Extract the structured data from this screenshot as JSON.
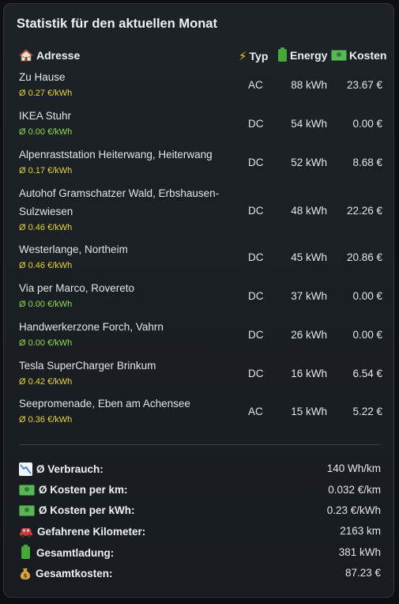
{
  "title": "Statistik für den aktuellen Monat",
  "header": {
    "address": "Adresse",
    "type": "Typ",
    "energy": "Energy",
    "cost": "Kosten"
  },
  "icons": {
    "address": "house-icon",
    "type": "lightning-icon",
    "energy": "battery-icon",
    "cost": "money-icon",
    "consumption": "chart-decreasing-icon",
    "cost_per_km": "money-icon",
    "cost_per_kwh": "money-icon",
    "distance": "car-icon",
    "total_charge": "battery-icon",
    "total_cost": "money-bag-icon"
  },
  "colors": {
    "avg_price": "#e8d532",
    "avg_price_zero": "#8fdc4a"
  },
  "rows": [
    {
      "address": "Zu Hause",
      "avg": "Ø 0.27 €/kWh",
      "type": "AC",
      "energy": "88 kWh",
      "cost": "23.67 €"
    },
    {
      "address": "IKEA Stuhr",
      "avg": "Ø 0.00 €/kWh",
      "type": "DC",
      "energy": "54 kWh",
      "cost": "0.00 €"
    },
    {
      "address": "Alpenraststation Heiterwang, Heiterwang",
      "avg": "Ø 0.17 €/kWh",
      "type": "DC",
      "energy": "52 kWh",
      "cost": "8.68 €"
    },
    {
      "address": "Autohof Gramschatzer Wald, Erbshausen-Sulzwiesen",
      "avg": "Ø 0.46 €/kWh",
      "type": "DC",
      "energy": "48 kWh",
      "cost": "22.26 €"
    },
    {
      "address": "Westerlange, Northeim",
      "avg": "Ø 0.46 €/kWh",
      "type": "DC",
      "energy": "45 kWh",
      "cost": "20.86 €"
    },
    {
      "address": "Via per Marco, Rovereto",
      "avg": "Ø 0.00 €/kWh",
      "type": "DC",
      "energy": "37 kWh",
      "cost": "0.00 €"
    },
    {
      "address": "Handwerkerzone Forch, Vahrn",
      "avg": "Ø 0.00 €/kWh",
      "type": "DC",
      "energy": "26 kWh",
      "cost": "0.00 €"
    },
    {
      "address": "Tesla SuperCharger Brinkum",
      "avg": "Ø 0.42 €/kWh",
      "type": "DC",
      "energy": "16 kWh",
      "cost": "6.54 €"
    },
    {
      "address": "Seepromenade, Eben am Achensee",
      "avg": "Ø 0.36 €/kWh",
      "type": "AC",
      "energy": "15 kWh",
      "cost": "5.22 €"
    }
  ],
  "stats": {
    "consumption_label": "Ø Verbrauch:",
    "consumption_value": "140 Wh/km",
    "cost_per_km_label": "Ø Kosten per km:",
    "cost_per_km_value": "0.032 €/km",
    "cost_per_kwh_label": "Ø Kosten per kWh:",
    "cost_per_kwh_value": "0.23 €/kWh",
    "distance_label": "Gefahrene Kilometer:",
    "distance_value": "2163 km",
    "total_charge_label": "Gesamtladung:",
    "total_charge_value": "381 kWh",
    "total_cost_label": "Gesamtkosten:",
    "total_cost_value": "87.23 €"
  }
}
